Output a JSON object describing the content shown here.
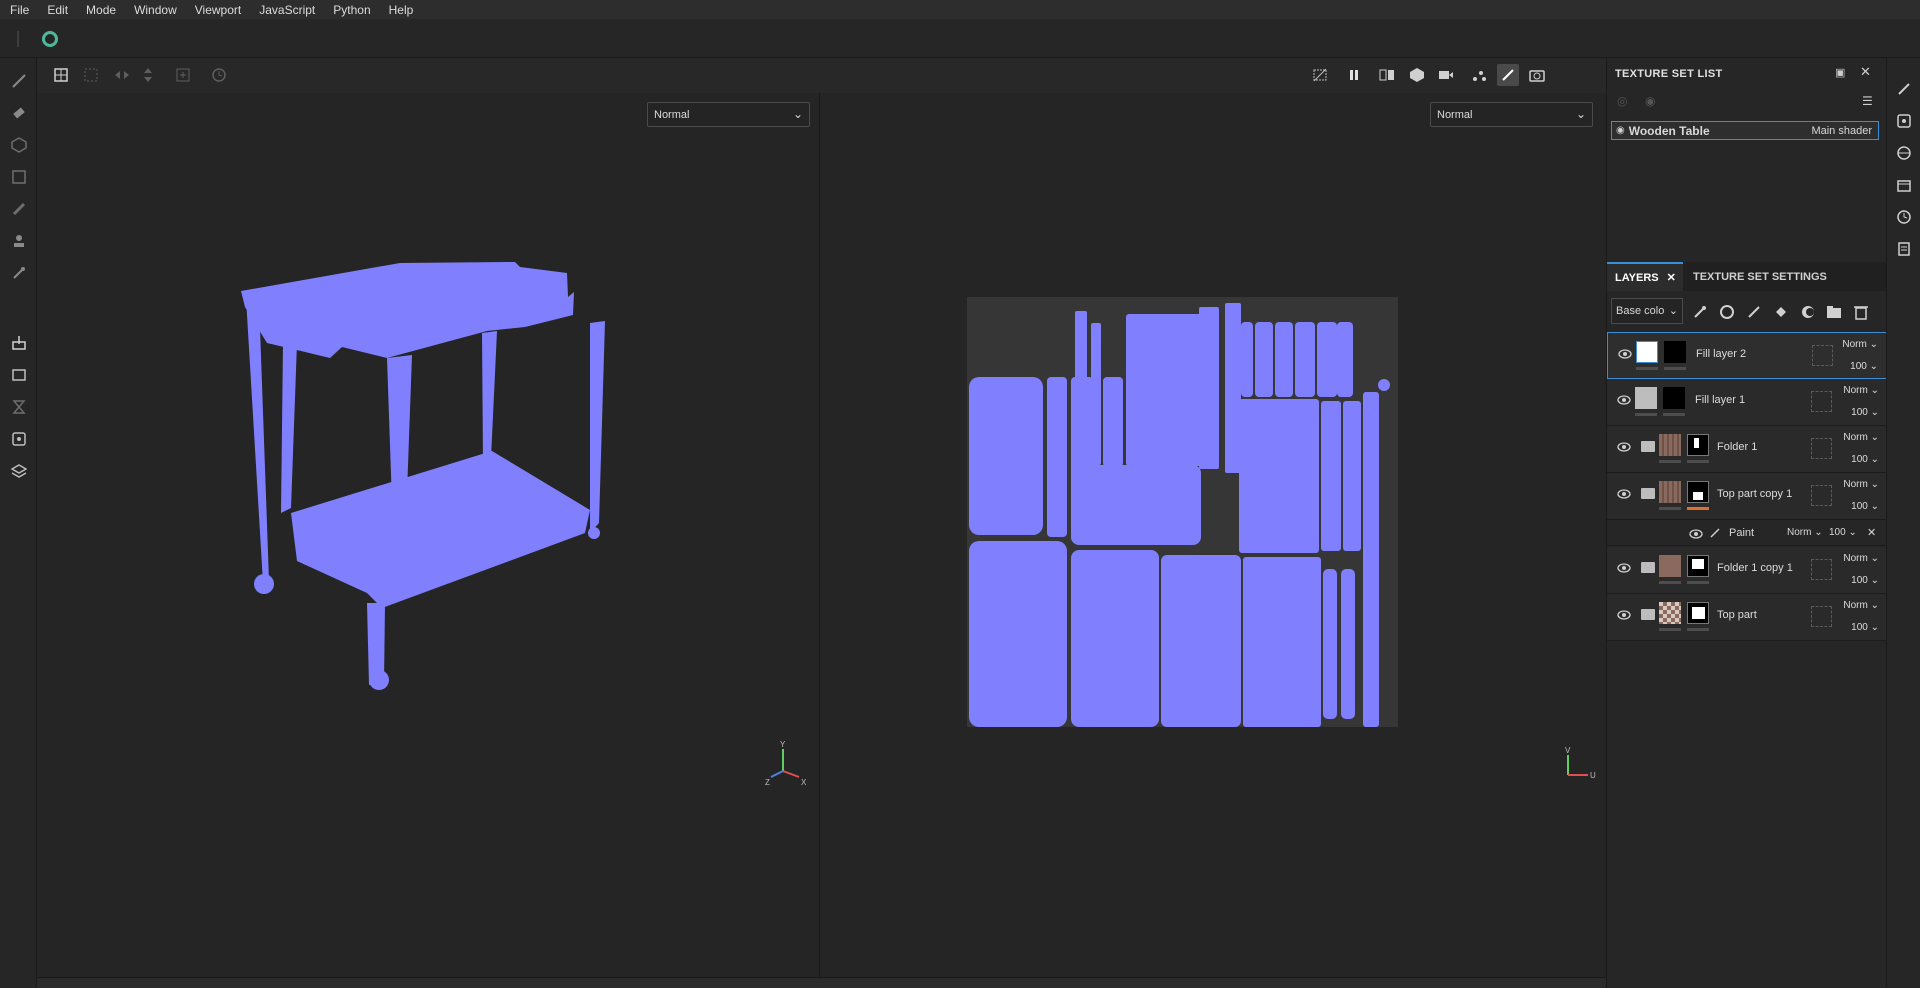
{
  "menu": [
    "File",
    "Edit",
    "Mode",
    "Window",
    "Viewport",
    "JavaScript",
    "Python",
    "Help"
  ],
  "viewports": {
    "left_mode": "Normal",
    "right_mode": "Normal"
  },
  "texture_set_list": {
    "title": "TEXTURE SET LIST",
    "item": {
      "name": "Wooden Table",
      "shader": "Main shader"
    }
  },
  "tabs": {
    "layers": "LAYERS",
    "texture_set_settings": "TEXTURE SET SETTINGS"
  },
  "channel_select": "Base colo",
  "layers": [
    {
      "name": "Fill layer 2",
      "blend": "Norm",
      "opacity": "100"
    },
    {
      "name": "Fill layer 1",
      "blend": "Norm",
      "opacity": "100"
    },
    {
      "name": "Folder 1",
      "blend": "Norm",
      "opacity": "100"
    },
    {
      "name": "Top part copy 1",
      "blend": "Norm",
      "opacity": "100"
    },
    {
      "name": "Folder 1 copy 1",
      "blend": "Norm",
      "opacity": "100"
    },
    {
      "name": "Top part",
      "blend": "Norm",
      "opacity": "100"
    }
  ],
  "effect": {
    "name": "Paint",
    "blend": "Norm",
    "opacity": "100"
  },
  "axes": {
    "x": "X",
    "y": "Y",
    "z": "Z",
    "u": "U",
    "v": "V"
  },
  "colors": {
    "mesh": "#8080ff",
    "selection": "#3a8ed6",
    "accent": "#4fb89a",
    "mask_bar": "#e0702a"
  },
  "icons": [
    "brush-icon",
    "eraser-icon",
    "projection-icon",
    "polyfill-icon",
    "smudge-icon",
    "clone-icon",
    "picker-icon",
    "export-icon",
    "bake-icon",
    "eye-icon",
    "folder-icon",
    "trash-icon",
    "camera-icon",
    "pause-icon"
  ]
}
